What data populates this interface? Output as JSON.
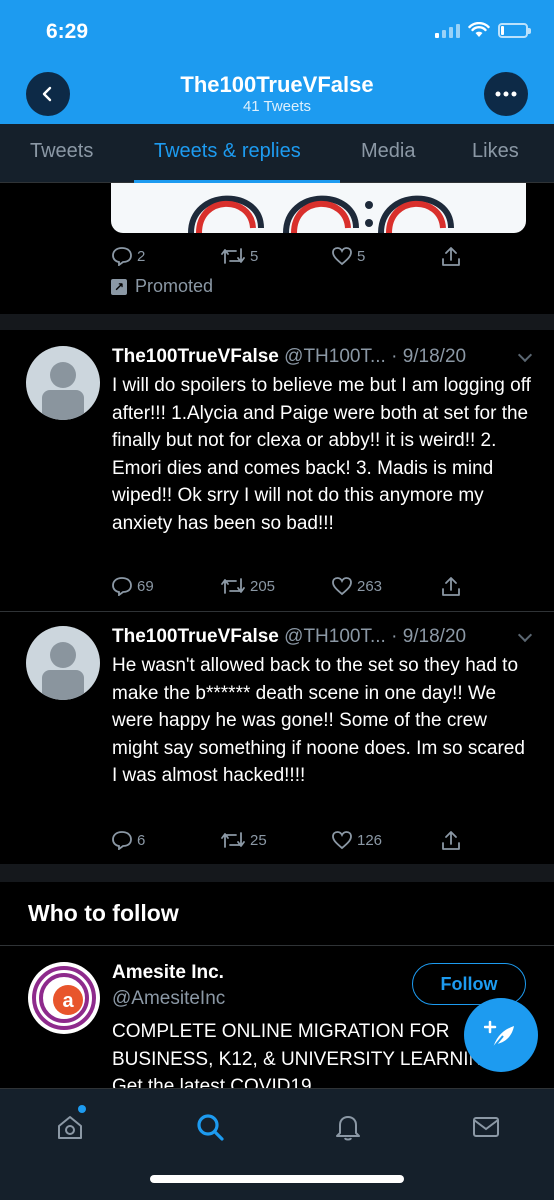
{
  "status": {
    "time": "6:29"
  },
  "header": {
    "title": "The100TrueVFalse",
    "subtitle": "41 Tweets"
  },
  "tabs": [
    {
      "label": "Tweets"
    },
    {
      "label": "Tweets & replies"
    },
    {
      "label": "Media"
    },
    {
      "label": "Likes"
    }
  ],
  "promoted_tweet": {
    "replies": "2",
    "retweets": "5",
    "likes": "5",
    "promoted_label": "Promoted"
  },
  "tweets": [
    {
      "name": "The100TrueVFalse",
      "handle": "@TH100T... · 9/18/20",
      "text": "I will do spoilers to believe me but I am logging off after!!! 1.Alycia and Paige were both at set for the finally but not for clexa or abby!! it is weird!! 2. Emori dies and comes back! 3. Madis is mind wiped!! Ok srry I will not do this anymore my anxiety has been so bad!!!",
      "replies": "69",
      "retweets": "205",
      "likes": "263"
    },
    {
      "name": "The100TrueVFalse",
      "handle": "@TH100T... · 9/18/20",
      "text": "He wasn't allowed back to the set so they had to make the b****** death scene in one day!! We were happy he was gone!! Some of the crew might say something if noone does. Im so scared I was almost hacked!!!!",
      "replies": "6",
      "retweets": "25",
      "likes": "126"
    }
  ],
  "who_to_follow": {
    "title": "Who to follow",
    "name": "Amesite Inc.",
    "handle": "@AmesiteInc",
    "bio": "COMPLETE ONLINE MIGRATION FOR BUSINESS, K12, & UNIVERSITY LEARNING. Get the latest COVID19",
    "follow_label": "Follow"
  },
  "colors": {
    "accent": "#1d9bf0",
    "background": "#000000",
    "secondary_text": "#8b98a5"
  }
}
